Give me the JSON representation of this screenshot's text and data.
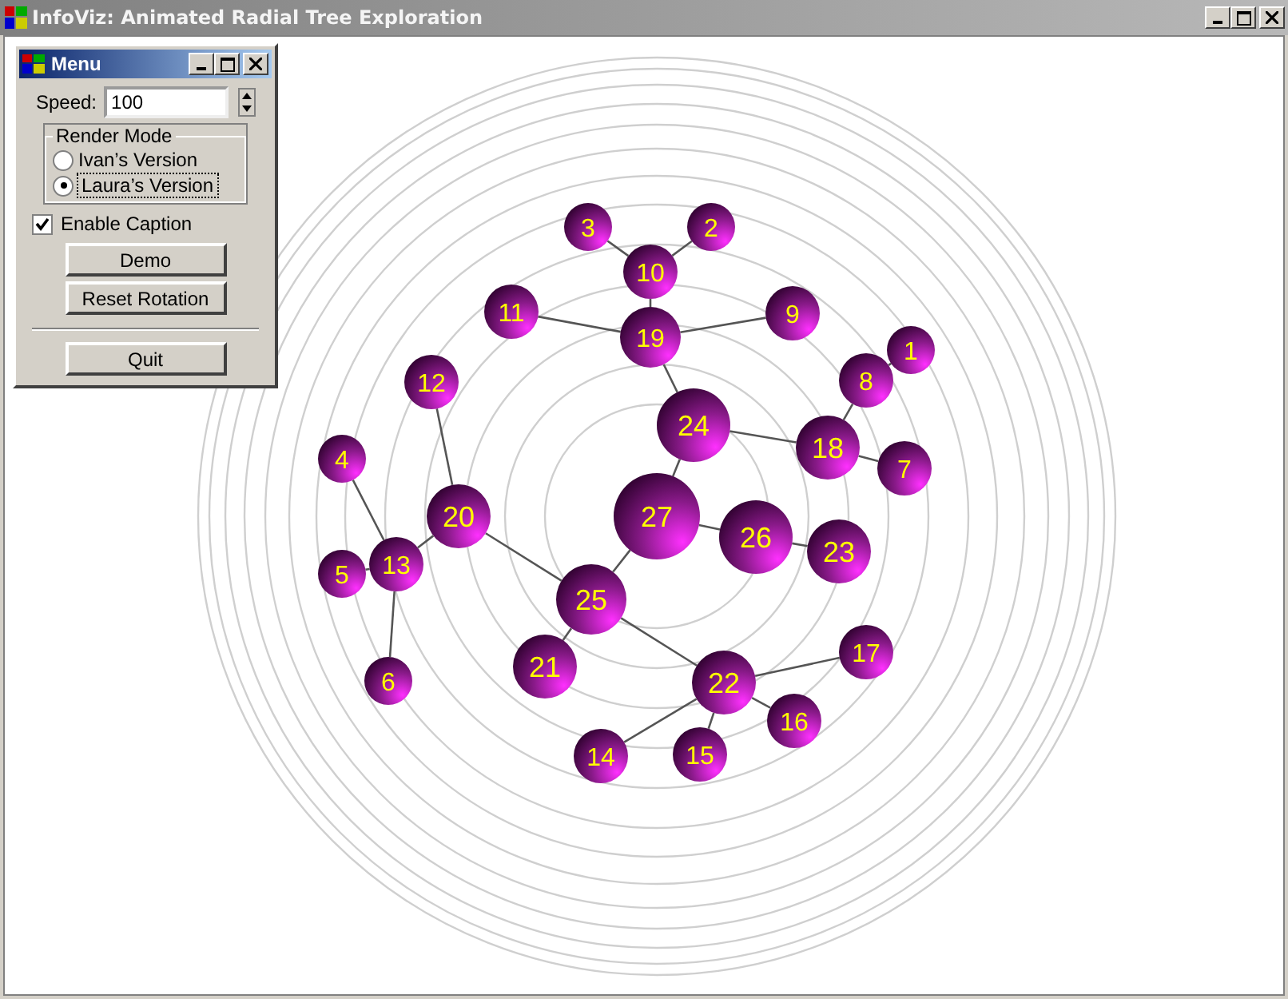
{
  "window": {
    "title": "InfoViz: Animated Radial Tree Exploration"
  },
  "menu": {
    "title": "Menu",
    "speed": {
      "label": "Speed:",
      "value": "100"
    },
    "render_mode": {
      "label": "Render Mode",
      "options": [
        {
          "label": "Ivan’s Version",
          "selected": false
        },
        {
          "label": "Laura’s Version",
          "selected": true
        }
      ]
    },
    "caption": {
      "label": "Enable Caption",
      "checked": true
    },
    "buttons": [
      "Demo",
      "Reset Rotation"
    ],
    "quit": "Quit"
  },
  "tree": {
    "label": "27",
    "children": [
      {
        "label": "24",
        "children": [
          {
            "label": "19",
            "children": [
              {
                "label": "10",
                "children": [
                  {
                    "label": "3"
                  },
                  {
                    "label": "2"
                  }
                ]
              },
              {
                "label": "11"
              },
              {
                "label": "9"
              }
            ]
          },
          {
            "label": "18",
            "children": [
              {
                "label": "8",
                "children": [
                  {
                    "label": "1"
                  }
                ]
              },
              {
                "label": "7"
              }
            ]
          }
        ]
      },
      {
        "label": "26",
        "children": [
          {
            "label": "23"
          }
        ]
      },
      {
        "label": "25",
        "children": [
          {
            "label": "20",
            "children": [
              {
                "label": "12"
              },
              {
                "label": "13",
                "children": [
                  {
                    "label": "4"
                  },
                  {
                    "label": "5"
                  },
                  {
                    "label": "6"
                  }
                ]
              }
            ]
          },
          {
            "label": "21"
          },
          {
            "label": "22",
            "children": [
              {
                "label": "17"
              },
              {
                "label": "16"
              },
              {
                "label": "15"
              },
              {
                "label": "14"
              }
            ]
          }
        ]
      }
    ]
  }
}
